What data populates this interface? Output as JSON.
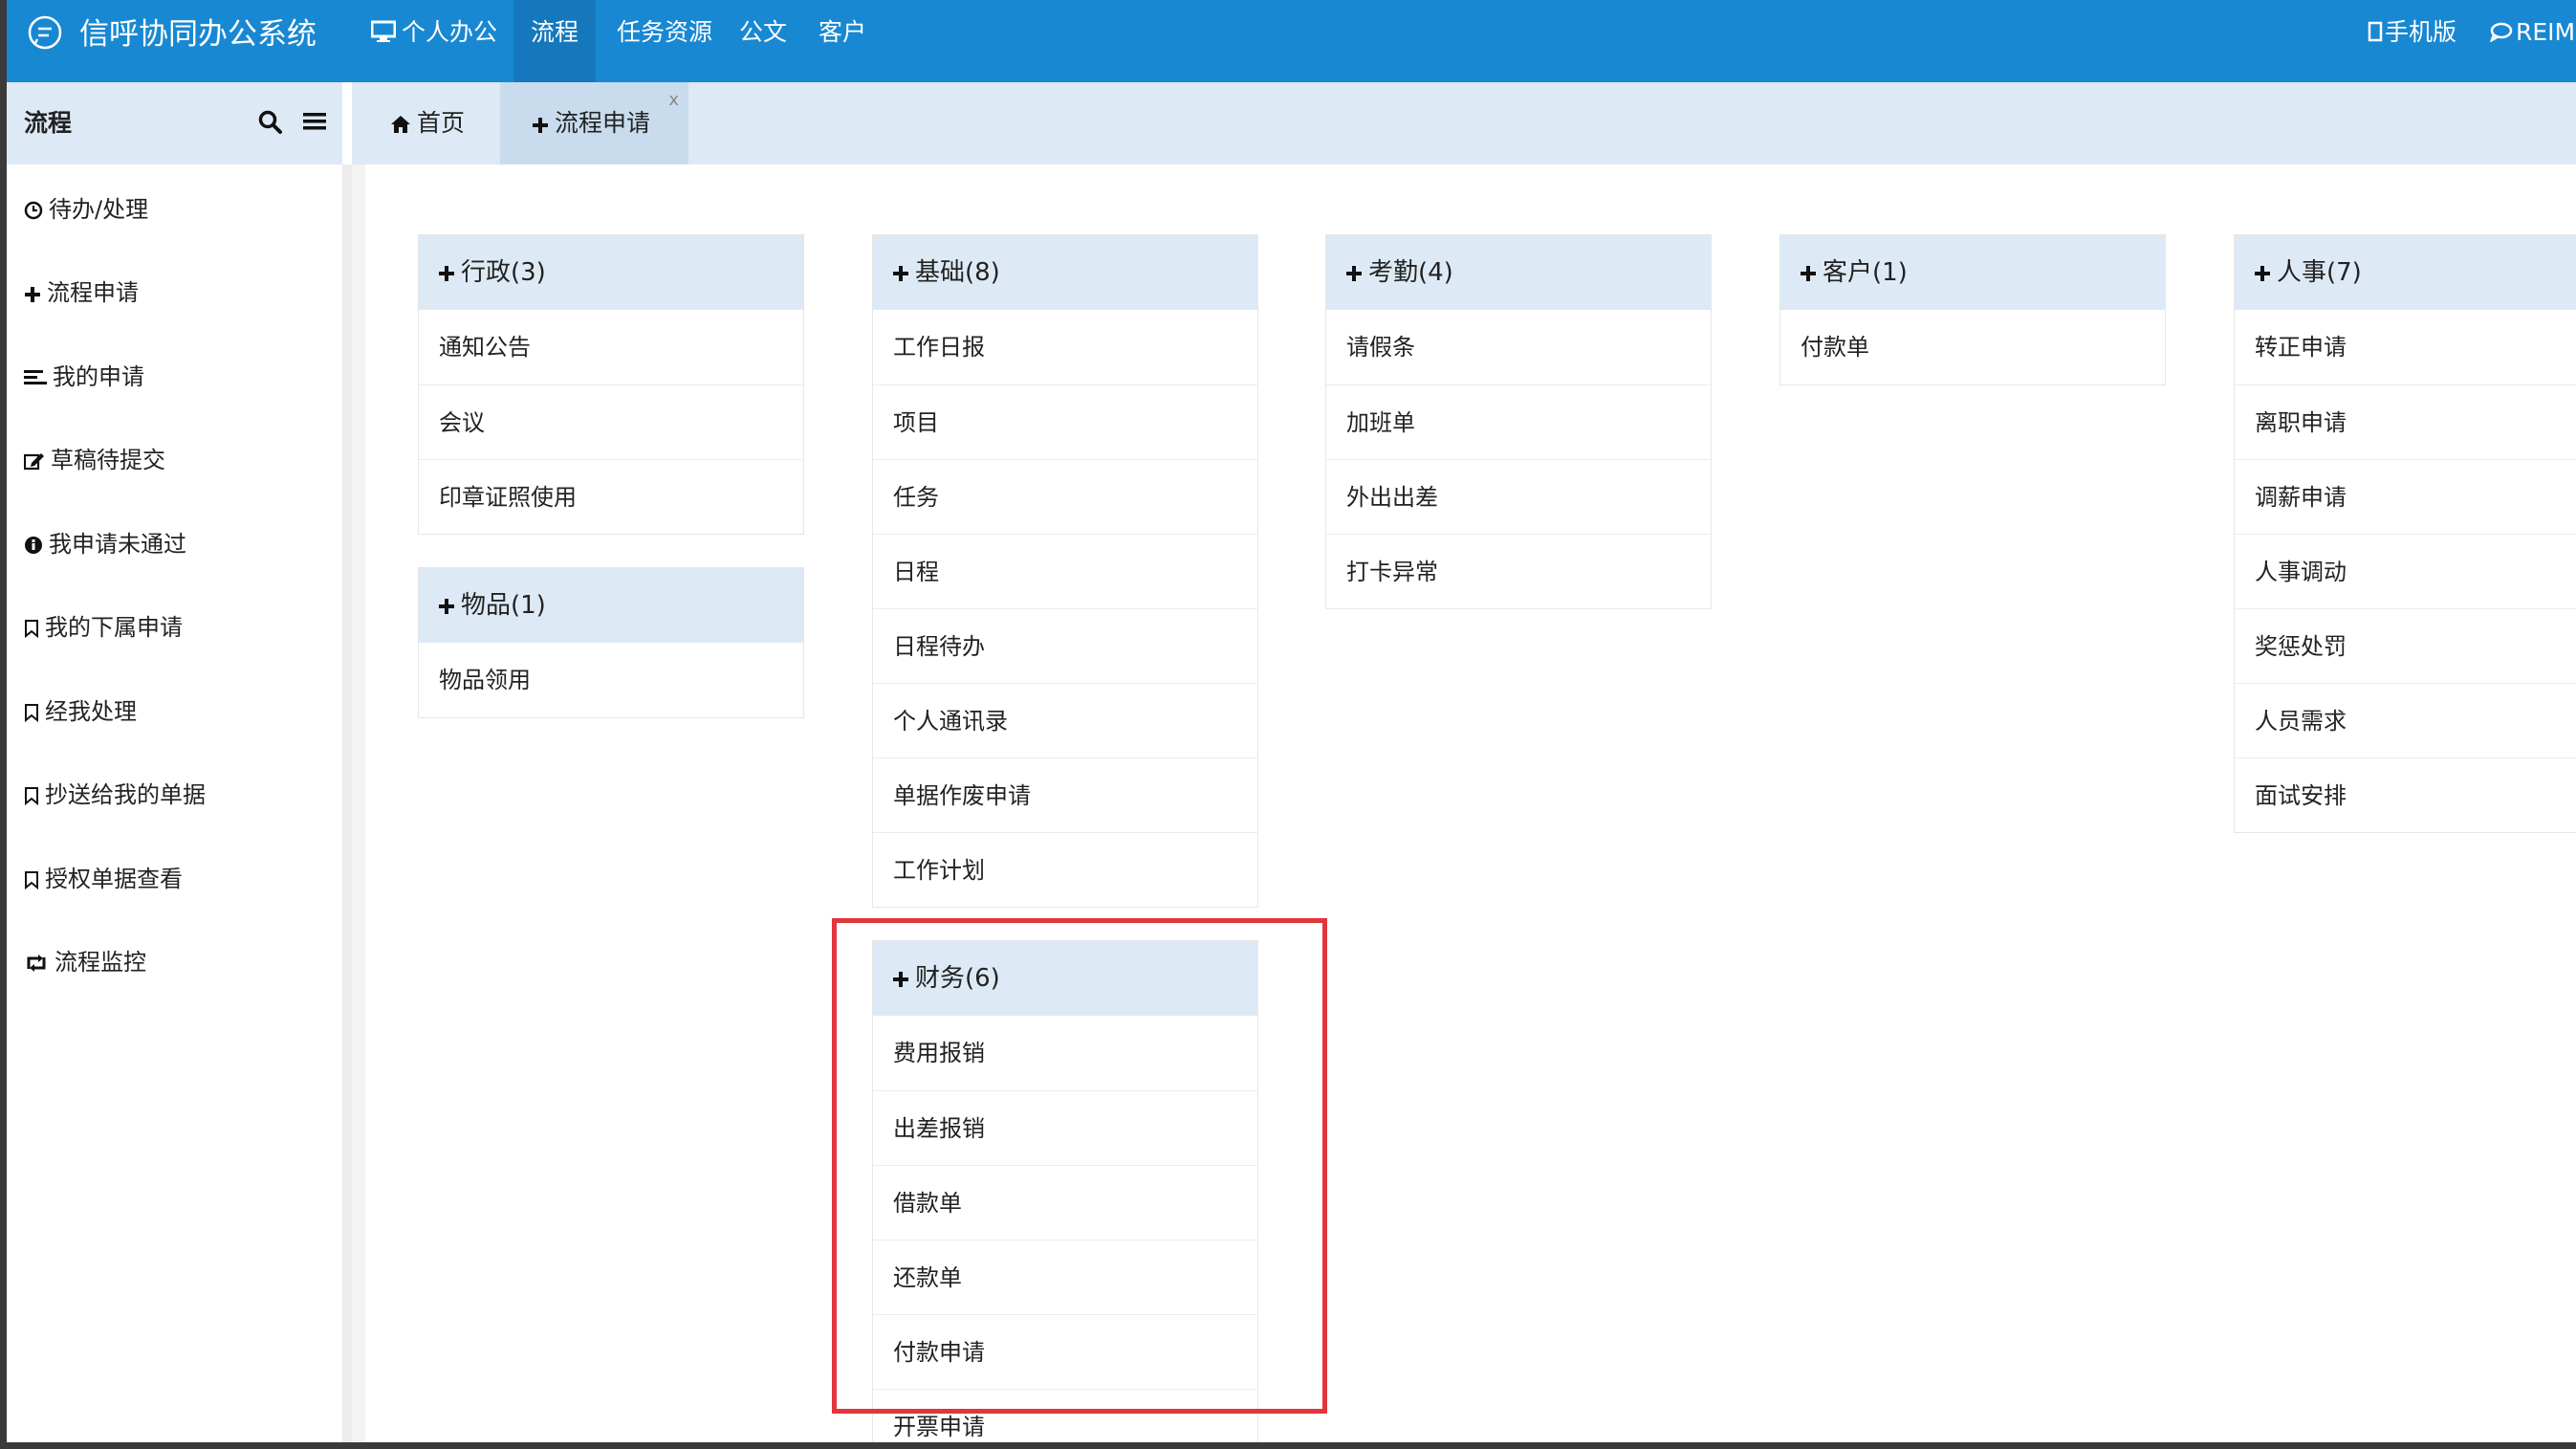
{
  "topbar": {
    "app_title": "信呼协同办公系统",
    "nav": [
      "个人办公",
      "流程",
      "任务资源",
      "公文",
      "客户"
    ],
    "mobile_label": "手机版",
    "reim_label": "REIM"
  },
  "sidebar": {
    "title": "流程",
    "items": [
      {
        "label": "待办/处理",
        "icon": "clock-icon"
      },
      {
        "label": "流程申请",
        "icon": "plus-icon"
      },
      {
        "label": "我的申请",
        "icon": "align-left-icon"
      },
      {
        "label": "草稿待提交",
        "icon": "edit-icon"
      },
      {
        "label": "我申请未通过",
        "icon": "info-icon"
      },
      {
        "label": "我的下属申请",
        "icon": "bookmark-icon"
      },
      {
        "label": "经我处理",
        "icon": "bookmark-icon"
      },
      {
        "label": "抄送给我的单据",
        "icon": "bookmark-icon"
      },
      {
        "label": "授权单据查看",
        "icon": "bookmark-icon"
      },
      {
        "label": "流程监控",
        "icon": "retweet-icon"
      }
    ]
  },
  "tabs": [
    {
      "label": "首页",
      "icon": "home-icon"
    },
    {
      "label": "流程申请",
      "icon": "plus-icon",
      "close": "x"
    }
  ],
  "categories": [
    {
      "title": "行政(3)",
      "items": [
        "通知公告",
        "会议",
        "印章证照使用"
      ]
    },
    {
      "title": "物品(1)",
      "items": [
        "物品领用"
      ]
    },
    {
      "title": "基础(8)",
      "items": [
        "工作日报",
        "项目",
        "任务",
        "日程",
        "日程待办",
        "个人通讯录",
        "单据作废申请",
        "工作计划"
      ]
    },
    {
      "title": "财务(6)",
      "items": [
        "费用报销",
        "出差报销",
        "借款单",
        "还款单",
        "付款申请",
        "开票申请"
      ]
    },
    {
      "title": "考勤(4)",
      "items": [
        "请假条",
        "加班单",
        "外出出差",
        "打卡异常"
      ]
    },
    {
      "title": "客户(1)",
      "items": [
        "付款单"
      ]
    },
    {
      "title": "人事(7)",
      "items": [
        "转正申请",
        "离职申请",
        "调薪申请",
        "人事调动",
        "奖惩处罚",
        "人员需求",
        "面试安排"
      ]
    }
  ],
  "colors": {
    "topbar": "#1888d2",
    "panel_header": "#ddeaf6",
    "highlight": "#e0363c"
  }
}
